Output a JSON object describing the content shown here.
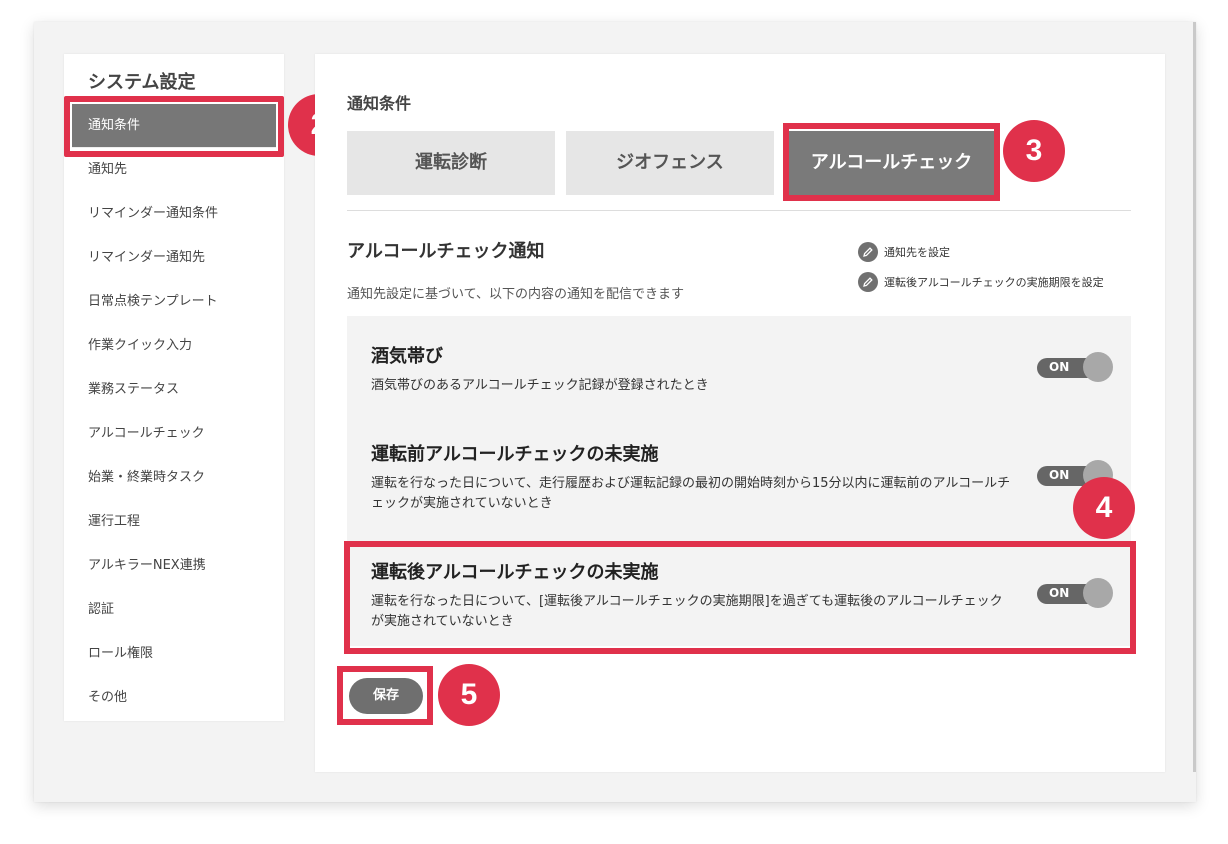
{
  "sidebar": {
    "title": "システム設定",
    "items": [
      {
        "label": "通知条件",
        "active": true
      },
      {
        "label": "通知先"
      },
      {
        "label": "リマインダー通知条件"
      },
      {
        "label": "リマインダー通知先"
      },
      {
        "label": "日常点検テンプレート"
      },
      {
        "label": "作業クイック入力"
      },
      {
        "label": "業務ステータス"
      },
      {
        "label": "アルコールチェック"
      },
      {
        "label": "始業・終業時タスク"
      },
      {
        "label": "運行工程"
      },
      {
        "label": "アルキラーNEX連携"
      },
      {
        "label": "認証"
      },
      {
        "label": "ロール権限"
      },
      {
        "label": "その他"
      }
    ]
  },
  "main": {
    "title": "通知条件",
    "tabs": [
      {
        "label": "運転診断"
      },
      {
        "label": "ジオフェンス"
      },
      {
        "label": "アルコールチェック",
        "active": true
      }
    ],
    "section": {
      "title": "アルコールチェック通知",
      "description": "通知先設定に基づいて、以下の内容の通知を配信できます",
      "links": [
        {
          "label": "通知先を設定",
          "icon": "pencil-icon"
        },
        {
          "label": "運転後アルコールチェックの実施期限を設定",
          "icon": "pencil-icon"
        }
      ]
    },
    "rules": [
      {
        "title": "酒気帯び",
        "description": "酒気帯びのあるアルコールチェック記録が登録されたとき",
        "toggle": "ON"
      },
      {
        "title": "運転前アルコールチェックの未実施",
        "description": "運転を行なった日について、走行履歴および運転記録の最初の開始時刻から15分以内に運転前のアルコールチェックが実施されていないとき",
        "toggle": "ON"
      },
      {
        "title": "運転後アルコールチェックの未実施",
        "description": "運転を行なった日について、[運転後アルコールチェックの実施期限]を過ぎても運転後のアルコールチェックが実施されていないとき",
        "toggle": "ON"
      }
    ],
    "save_label": "保存"
  },
  "annotations": {
    "badges": [
      "2",
      "3",
      "4",
      "5"
    ],
    "highlight_color": "#e0314b"
  },
  "colors": {
    "active_gray": "#777777",
    "badge_red": "#e0314b"
  }
}
